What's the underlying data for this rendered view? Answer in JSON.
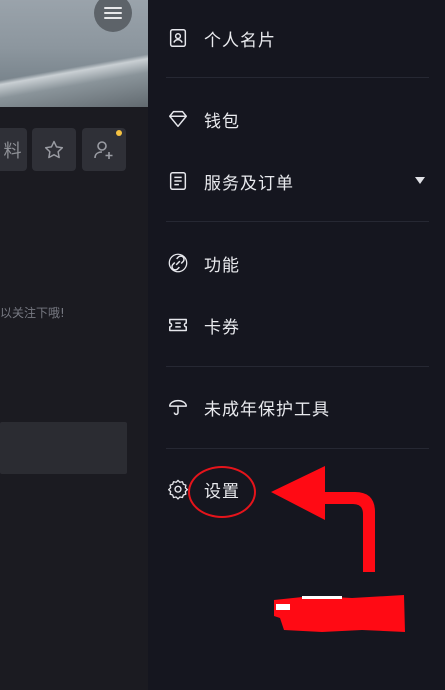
{
  "left_page": {
    "action_partial_label": "料",
    "hint_text": "可以关注下哦!"
  },
  "drawer": {
    "items": [
      {
        "label": "个人名片",
        "icon": "id-card-icon"
      },
      {
        "label": "钱包",
        "icon": "diamond-icon"
      },
      {
        "label": "服务及订单",
        "icon": "list-doc-icon"
      },
      {
        "label": "功能",
        "icon": "link-icon"
      },
      {
        "label": "卡券",
        "icon": "ticket-icon"
      },
      {
        "label": "未成年保护工具",
        "icon": "umbrella-icon"
      },
      {
        "label": "设置",
        "icon": "gear-icon"
      }
    ]
  },
  "colors": {
    "annotation_red": "#e5141b",
    "drawer_bg": "#15161f",
    "notification_dot": "#f5c242"
  }
}
